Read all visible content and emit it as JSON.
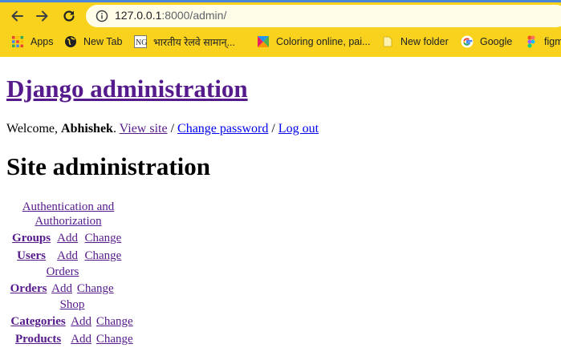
{
  "browser": {
    "url_host": "127.0.0.1",
    "url_path": ":8000/admin/",
    "bookmarks": [
      {
        "label": "Apps",
        "icon": "apps-grid-icon"
      },
      {
        "label": "New Tab",
        "icon": "globe-icon"
      },
      {
        "label": "भारतीय रेलवे सामान्...",
        "icon": "ng-icon"
      },
      {
        "label": "Coloring online, pai...",
        "icon": "coloring-icon"
      },
      {
        "label": "New folder",
        "icon": "folder-icon"
      },
      {
        "label": "Google",
        "icon": "google-icon"
      },
      {
        "label": "figm",
        "icon": "figma-icon"
      }
    ]
  },
  "header": {
    "site_title": "Django administration",
    "welcome_prefix": "Welcome, ",
    "username": "Abhishek",
    "welcome_suffix": ". ",
    "view_site": "View site",
    "sep1": " / ",
    "change_password": "Change password",
    "sep2": " / ",
    "log_out": "Log out"
  },
  "main": {
    "heading": "Site administration",
    "modules": [
      {
        "caption": "Authentication and Authorization",
        "models": [
          {
            "name": "Groups",
            "add": "Add",
            "change": "Change"
          },
          {
            "name": "Users",
            "add": "Add",
            "change": "Change"
          }
        ]
      },
      {
        "caption": "Orders",
        "models": [
          {
            "name": "Orders",
            "add": "Add",
            "change": "Change"
          }
        ]
      },
      {
        "caption": "Shop",
        "models": [
          {
            "name": "Categories",
            "add": "Add",
            "change": "Change"
          },
          {
            "name": "Products",
            "add": "Add",
            "change": "Change"
          }
        ]
      }
    ]
  },
  "colors": {
    "chrome_bg": "#f8d21c",
    "visited_link": "#551a8b",
    "link": "#0000ee"
  }
}
